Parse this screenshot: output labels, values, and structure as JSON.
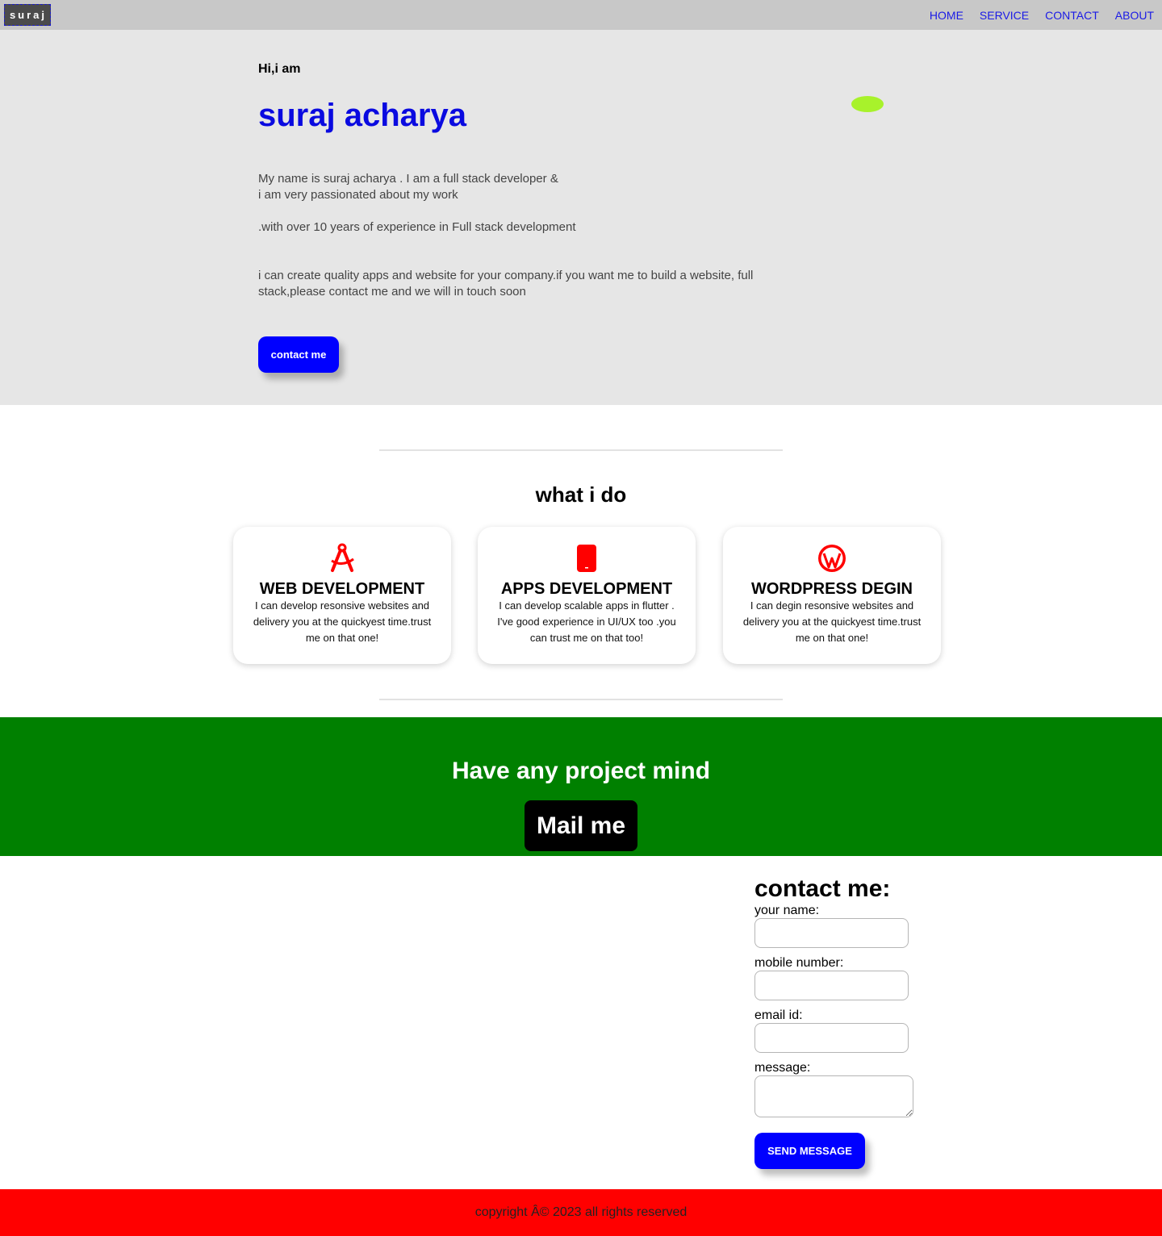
{
  "navbar": {
    "logo": "suraj",
    "links": [
      "HOME",
      "SERVICE",
      "CONTACT",
      "ABOUT"
    ]
  },
  "hero": {
    "greeting": "Hi,i am",
    "name": "suraj acharya",
    "intro_line1": "My name is suraj acharya . I am a full stack developer &",
    "intro_line2": "i am very passionated about my work",
    "experience": ".with over 10 years of experience in Full stack development",
    "pitch": "i can create quality apps and website for your company.if you want me to build a website, full stack,please contact me and we will in touch soon",
    "contact_button": "contact me"
  },
  "services": {
    "title": "what i do",
    "cards": [
      {
        "icon": "compass-icon",
        "title": "WEB DEVELOPMENT",
        "text": "I can develop resonsive websites and delivery you at the quickyest time.trust me on that one!"
      },
      {
        "icon": "mobile-icon",
        "title": "APPS DEVELOPMENT",
        "text": "I can develop scalable apps in flutter . I've good experience in UI/UX too .you can trust me on that too!"
      },
      {
        "icon": "wordpress-icon",
        "title": "WORDPRESS DEGIN",
        "text": "I can degin resonsive websites and delivery you at the quickyest time.trust me on that one!"
      }
    ]
  },
  "cta": {
    "title": "Have any project mind",
    "button": "Mail me"
  },
  "contact_form": {
    "title": "contact me:",
    "name_label": "your name:",
    "mobile_label": "mobile number:",
    "email_label": "email id:",
    "message_label": "message:",
    "send_button": "SEND MESSAGE"
  },
  "footer": {
    "text": "copyright Â© 2023 all rights reserved"
  },
  "colors": {
    "accent": "#0000ff",
    "icon": "#ff0000",
    "cta_bg": "#008000",
    "footer_bg": "#ff0000",
    "blob": "#a8f22b"
  }
}
